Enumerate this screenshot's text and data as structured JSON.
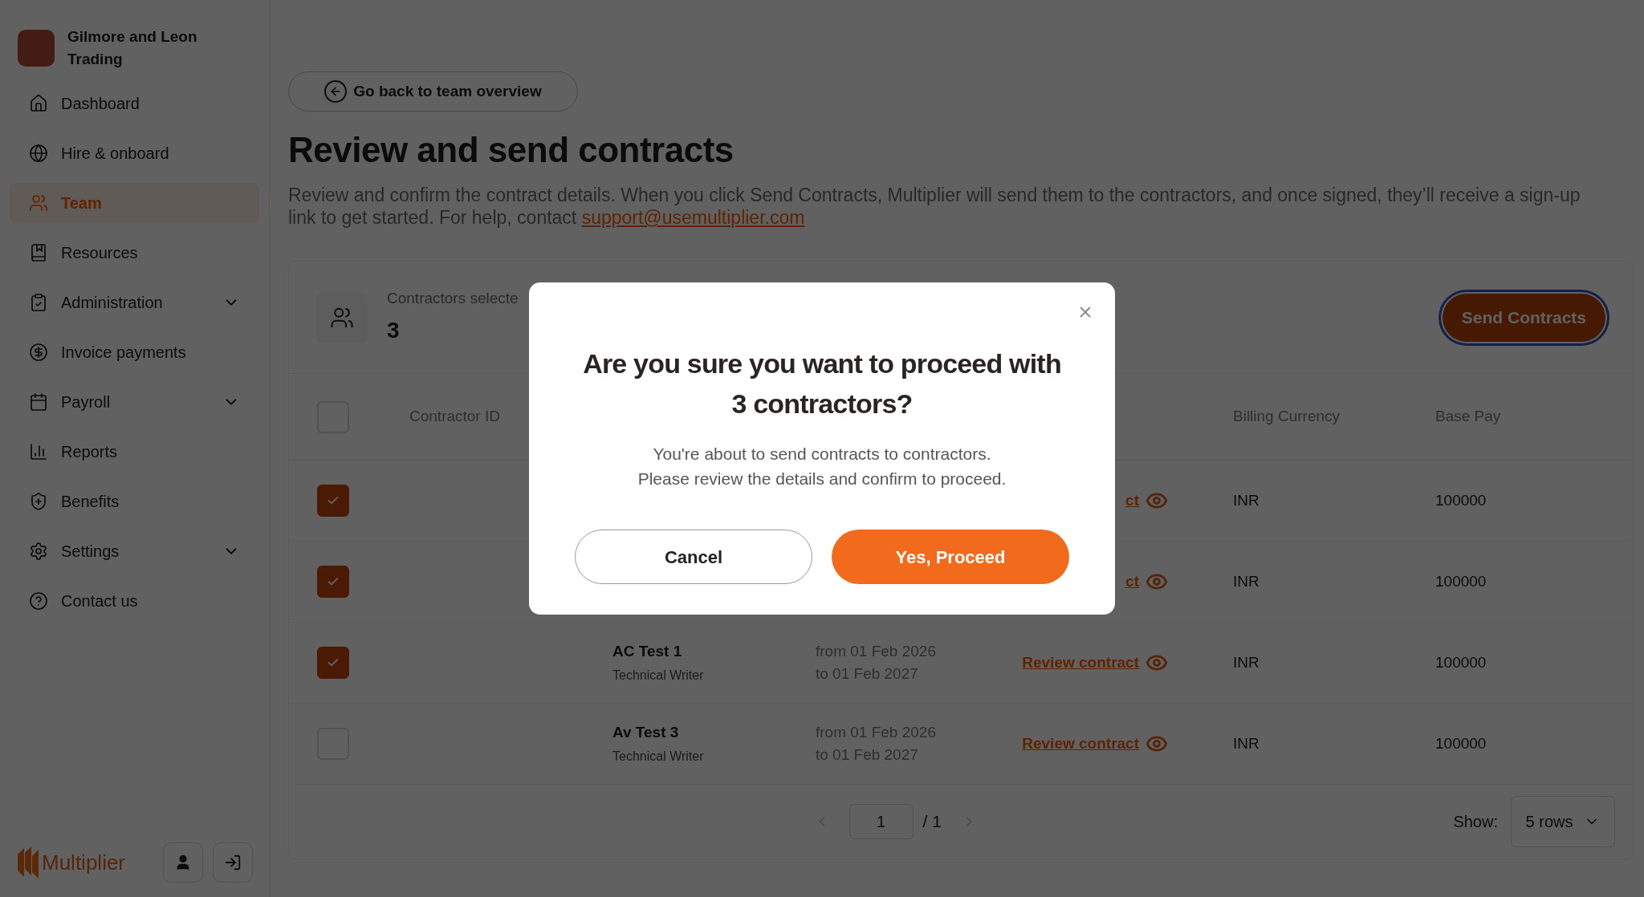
{
  "sidebar": {
    "company": "Gilmore and Leon Trading",
    "items": [
      {
        "label": "Dashboard",
        "selected": false,
        "has_submenu": false
      },
      {
        "label": "Hire & onboard",
        "selected": false,
        "has_submenu": false
      },
      {
        "label": "Team",
        "selected": true,
        "has_submenu": false
      },
      {
        "label": "Resources",
        "selected": false,
        "has_submenu": false
      },
      {
        "label": "Administration",
        "selected": false,
        "has_submenu": true
      },
      {
        "label": "Invoice payments",
        "selected": false,
        "has_submenu": false
      },
      {
        "label": "Payroll",
        "selected": false,
        "has_submenu": true
      },
      {
        "label": "Reports",
        "selected": false,
        "has_submenu": false
      },
      {
        "label": "Benefits",
        "selected": false,
        "has_submenu": false
      },
      {
        "label": "Settings",
        "selected": false,
        "has_submenu": true
      },
      {
        "label": "Contact us",
        "selected": false,
        "has_submenu": false
      }
    ],
    "brand": "Multiplier"
  },
  "back_button": "Go back to team overview",
  "title": "Review and send contracts",
  "description": {
    "text": "Review and confirm the contract details. When you click Send Contracts, Multiplier will send them to the contractors, and once signed, they’ll receive a sign-up link to get started. For help, contact",
    "link": "support@usemultiplier.com"
  },
  "summary": {
    "label": "Contractors selecte",
    "count": "3",
    "action": "Send Contracts"
  },
  "table": {
    "columns": [
      {
        "label": "Contractor ID"
      },
      {
        "label": "Billing Currency"
      },
      {
        "label": "Base Pay"
      }
    ],
    "header_checked": false,
    "rows": [
      {
        "checked": true,
        "review_link": "ct",
        "currency": "INR",
        "base_pay": "100000"
      },
      {
        "checked": true,
        "review_link": "ct",
        "currency": "INR",
        "base_pay": "100000"
      },
      {
        "checked": true,
        "name": "AC Test 1",
        "role": "Technical Writer",
        "dates": [
          "from 01 Feb 2026",
          "to 01 Feb 2027"
        ],
        "review_link": "Review contract",
        "currency": "INR",
        "base_pay": "100000"
      },
      {
        "checked": false,
        "name": "Av Test 3",
        "role": "Technical Writer",
        "dates": [
          "from 01 Feb 2026",
          "to 01 Feb 2027"
        ],
        "review_link": "Review contract",
        "currency": "INR",
        "base_pay": "100000"
      }
    ]
  },
  "pagination": {
    "page": "1",
    "total": "/ 1",
    "show_label": "Show:",
    "rows_option": "5 rows"
  },
  "dialog": {
    "title": "Are you sure you want to proceed with 3 contractors?",
    "message": [
      "You're about to send contracts to contractors.",
      "Please review the details and confirm to proceed."
    ],
    "buttons": [
      {
        "label": "Cancel",
        "kind": "secondary"
      },
      {
        "label": "Yes, Proceed",
        "kind": "primary"
      }
    ]
  }
}
